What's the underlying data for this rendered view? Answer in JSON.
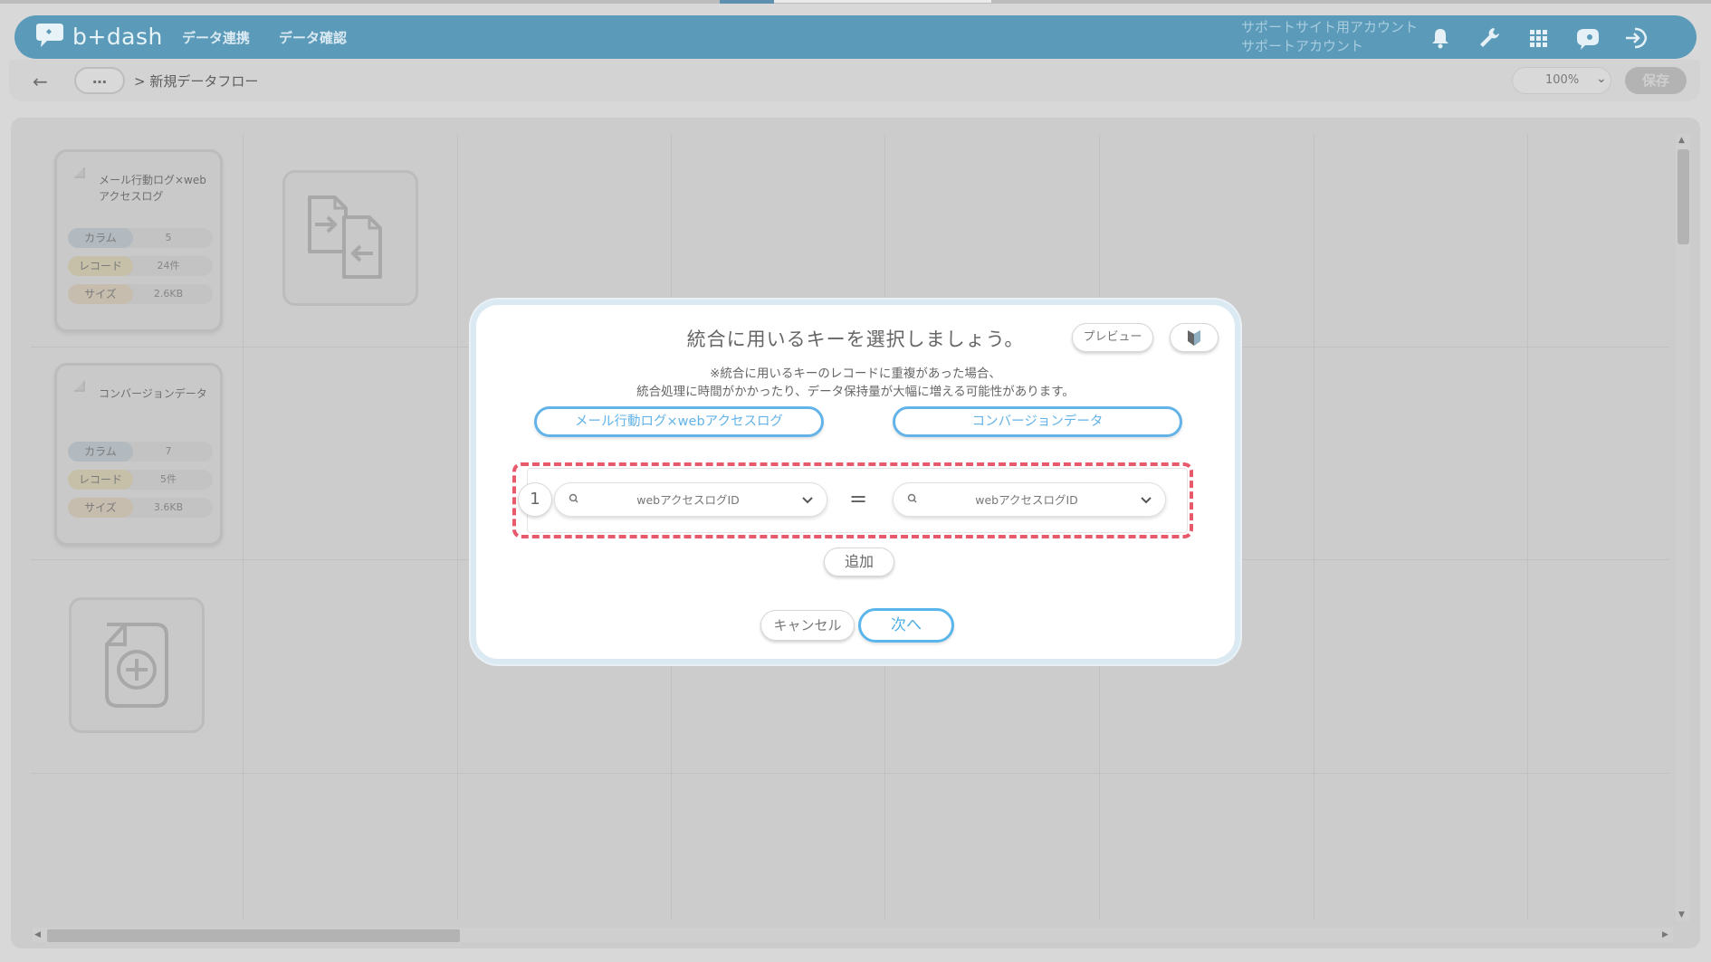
{
  "app": {
    "logo_text": "b+dash",
    "nav": [
      "データ連携",
      "データ確認"
    ],
    "account_line1": "サポートサイト用アカウント",
    "account_line2": "サポートアカウント",
    "header_icons": [
      "bell-icon",
      "wrench-icon",
      "grid-icon",
      "bot-icon",
      "logout-icon"
    ],
    "brand_color": "#5b9bb9"
  },
  "toolbar": {
    "back_icon": "←",
    "ellipsis": "…",
    "breadcrumb": "> 新規データフロー",
    "zoom": "100%",
    "save_label": "保存"
  },
  "canvas": {
    "cards": [
      {
        "title": "メール行動ログ×webアクセスログ",
        "column_label": "カラム",
        "column_value": "5",
        "record_label": "レコード",
        "record_value": "24件",
        "size_label": "サイズ",
        "size_value": "2.6KB"
      },
      {
        "title": "コンバージョンデータ",
        "column_label": "カラム",
        "column_value": "7",
        "record_label": "レコード",
        "record_value": "5件",
        "size_label": "サイズ",
        "size_value": "3.6KB"
      }
    ]
  },
  "modal": {
    "title": "統合に用いるキーを選択しましょう。",
    "preview_label": "プレビュー",
    "note_line1": "※統合に用いるキーのレコードに重複があった場合、",
    "note_line2": "統合処理に時間がかかったり、データ保持量が大幅に増える可能性があります。",
    "source_left": "メール行動ログ×webアクセスログ",
    "source_right": "コンバージョンデータ",
    "key_rows": [
      {
        "index": "1",
        "left_key": "webアクセスログID",
        "operator": "=",
        "right_key": "webアクセスログID"
      }
    ],
    "add_label": "追加",
    "cancel_label": "キャンセル",
    "next_label": "次へ",
    "accent_color": "#5ab6ea",
    "highlight_color": "#e8596b"
  }
}
